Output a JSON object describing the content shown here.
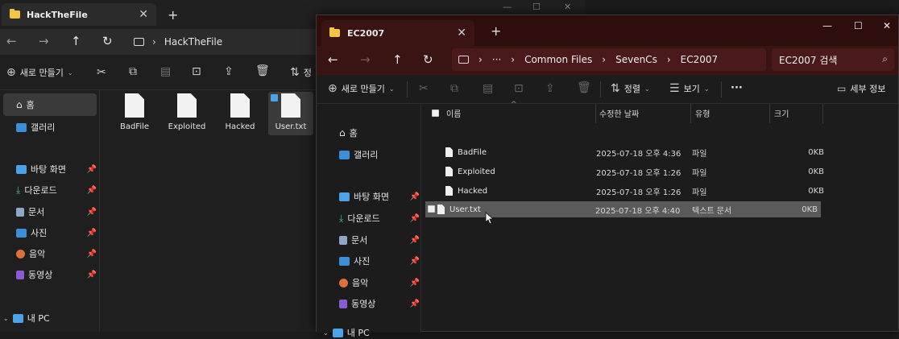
{
  "bg_window": {
    "tab_title": "HackTheFile",
    "address": "HackTheFile",
    "new_label": "새로 만들기",
    "sort_label": "정",
    "sidebar": [
      {
        "label": "홈",
        "icon": "home-icon"
      },
      {
        "label": "갤러리",
        "icon": "gallery-icon"
      },
      {
        "label": "바탕 화면",
        "icon": "desktop-icon"
      },
      {
        "label": "다운로드",
        "icon": "download-icon"
      },
      {
        "label": "문서",
        "icon": "document-icon"
      },
      {
        "label": "사진",
        "icon": "picture-icon"
      },
      {
        "label": "음악",
        "icon": "music-icon"
      },
      {
        "label": "동영상",
        "icon": "video-icon"
      },
      {
        "label": "내 PC",
        "icon": "pc-icon"
      }
    ],
    "files": [
      "BadFile",
      "Exploited",
      "Hacked",
      "User.txt"
    ]
  },
  "fg_window": {
    "tab_title": "EC2007",
    "breadcrumb": [
      "Common Files",
      "SevenCs",
      "EC2007"
    ],
    "breadcrumb_more": "···",
    "search_placeholder": "EC2007 검색",
    "cmd": {
      "new_label": "새로 만들기",
      "sort_label": "정렬",
      "view_label": "보기",
      "more_label": "···",
      "details_label": "세부 정보"
    },
    "sidebar": [
      {
        "label": "홈",
        "icon": "home-icon"
      },
      {
        "label": "갤러리",
        "icon": "gallery-icon"
      },
      {
        "label": "바탕 화면",
        "icon": "desktop-icon"
      },
      {
        "label": "다운로드",
        "icon": "download-icon"
      },
      {
        "label": "문서",
        "icon": "document-icon"
      },
      {
        "label": "사진",
        "icon": "picture-icon"
      },
      {
        "label": "음악",
        "icon": "music-icon"
      },
      {
        "label": "동영상",
        "icon": "video-icon"
      },
      {
        "label": "내 PC",
        "icon": "pc-icon"
      }
    ],
    "columns": {
      "name": "이름",
      "date": "수정한 날짜",
      "type": "유형",
      "size": "크기"
    },
    "rows": [
      {
        "name": "BadFile",
        "date": "2025-07-18 오후 4:36",
        "type": "파일",
        "size": "0KB"
      },
      {
        "name": "Exploited",
        "date": "2025-07-18 오후 1:26",
        "type": "파일",
        "size": "0KB"
      },
      {
        "name": "Hacked",
        "date": "2025-07-18 오후 1:26",
        "type": "파일",
        "size": "0KB"
      },
      {
        "name": "User.txt",
        "date": "2025-07-18 오후 4:40",
        "type": "텍스트 문서",
        "size": "0KB"
      }
    ],
    "selected_row": "User.txt"
  },
  "colors": {
    "fg_titlebar": "#2e0d0d",
    "fg_nav": "#3a1313",
    "folder": "#f4c542",
    "selection": "#5a5a5a"
  }
}
